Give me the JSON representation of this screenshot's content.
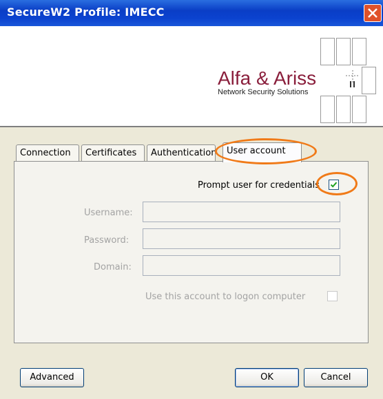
{
  "window": {
    "title": "SecureW2 Profile: IMECC",
    "close_icon": "close-x-icon"
  },
  "banner": {
    "brand_name": "Alfa & Ariss",
    "brand_tagline": "Network Security Solutions"
  },
  "tabs": [
    {
      "label": "Connection",
      "active": false
    },
    {
      "label": "Certificates",
      "active": false
    },
    {
      "label": "Authentication",
      "active": false
    },
    {
      "label": "User account",
      "active": true
    }
  ],
  "user_account": {
    "prompt_label": "Prompt user for credentials",
    "prompt_checked": true,
    "username_label": "Username:",
    "username_value": "",
    "password_label": "Password:",
    "password_value": "",
    "domain_label": "Domain:",
    "domain_value": "",
    "logon_label": "Use this account to logon computer",
    "logon_checked": false
  },
  "buttons": {
    "advanced": "Advanced",
    "ok": "OK",
    "cancel": "Cancel"
  },
  "colors": {
    "titlebar": "#0b42cf",
    "brand": "#8a1f3c",
    "annotation": "#f07a18"
  }
}
